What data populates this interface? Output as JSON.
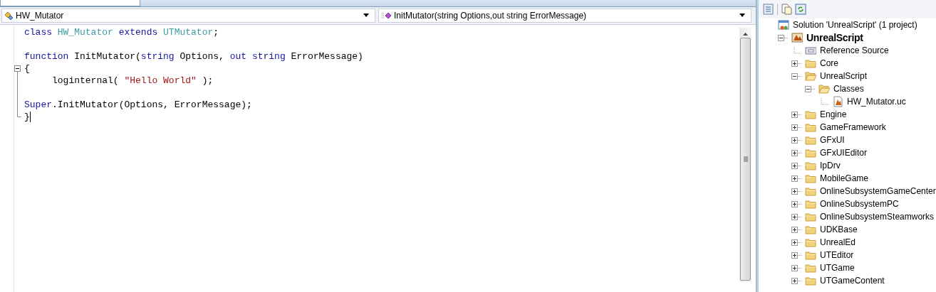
{
  "editor": {
    "class_dropdown": "HW_Mutator",
    "member_dropdown": "InitMutator(string Options,out string ErrorMessage)",
    "lines": [
      {
        "kind": "plain",
        "tokens": [
          {
            "kind": "keyword",
            "text": "class "
          },
          {
            "kind": "type",
            "text": "HW_Mutator "
          },
          {
            "kind": "keyword",
            "text": "extends "
          },
          {
            "kind": "type",
            "text": "UTMutator"
          },
          {
            "kind": "plain",
            "text": ";"
          }
        ]
      },
      {
        "kind": "plain"
      },
      {
        "kind": "plain",
        "tokens": [
          {
            "kind": "keyword",
            "text": "function "
          },
          {
            "kind": "plain",
            "text": "InitMutator("
          },
          {
            "kind": "keyword",
            "text": "string "
          },
          {
            "kind": "plain",
            "text": "Options, "
          },
          {
            "kind": "keyword",
            "text": "out string "
          },
          {
            "kind": "plain",
            "text": "ErrorMessage)"
          }
        ]
      },
      {
        "kind": "fold_start",
        "tokens": [
          {
            "kind": "plain",
            "text": "{"
          }
        ]
      },
      {
        "kind": "fold_body",
        "tokens": [
          {
            "kind": "plain",
            "text": "     loginternal( "
          },
          {
            "kind": "string",
            "text": "\"Hello World\""
          },
          {
            "kind": "plain",
            "text": " );"
          }
        ]
      },
      {
        "kind": "fold_body"
      },
      {
        "kind": "fold_body",
        "tokens": [
          {
            "kind": "keyword",
            "text": "Super"
          },
          {
            "kind": "plain",
            "text": ".InitMutator(Options, ErrorMessage);"
          }
        ]
      },
      {
        "kind": "fold_end",
        "tokens": [
          {
            "kind": "plain",
            "text": "}"
          }
        ],
        "caret": true
      }
    ]
  },
  "solution_explorer": {
    "tree": [
      {
        "kind": "solution",
        "label": "Solution 'UnrealScript' (1 project)",
        "children": [
          {
            "kind": "project",
            "label": "UnrealScript",
            "expanded": true,
            "children": [
              {
                "kind": "reference",
                "label": "Reference Source"
              },
              {
                "kind": "folder",
                "label": "Core",
                "expanded": false
              },
              {
                "kind": "folder",
                "label": "UnrealScript",
                "expanded": true,
                "children": [
                  {
                    "kind": "folder",
                    "label": "Classes",
                    "expanded": true,
                    "children": [
                      {
                        "kind": "file",
                        "label": "HW_Mutator.uc"
                      }
                    ]
                  }
                ]
              },
              {
                "kind": "folder",
                "label": "Engine",
                "expanded": false
              },
              {
                "kind": "folder",
                "label": "GameFramework",
                "expanded": false
              },
              {
                "kind": "folder",
                "label": "GFxUI",
                "expanded": false
              },
              {
                "kind": "folder",
                "label": "GFxUIEditor",
                "expanded": false
              },
              {
                "kind": "folder",
                "label": "IpDrv",
                "expanded": false
              },
              {
                "kind": "folder",
                "label": "MobileGame",
                "expanded": false
              },
              {
                "kind": "folder",
                "label": "OnlineSubsystemGameCenter",
                "expanded": false
              },
              {
                "kind": "folder",
                "label": "OnlineSubsystemPC",
                "expanded": false
              },
              {
                "kind": "folder",
                "label": "OnlineSubsystemSteamworks",
                "expanded": false
              },
              {
                "kind": "folder",
                "label": "UDKBase",
                "expanded": false
              },
              {
                "kind": "folder",
                "label": "UnrealEd",
                "expanded": false
              },
              {
                "kind": "folder",
                "label": "UTEditor",
                "expanded": false
              },
              {
                "kind": "folder",
                "label": "UTGame",
                "expanded": false
              },
              {
                "kind": "folder",
                "label": "UTGameContent",
                "expanded": false
              }
            ]
          }
        ]
      }
    ]
  }
}
